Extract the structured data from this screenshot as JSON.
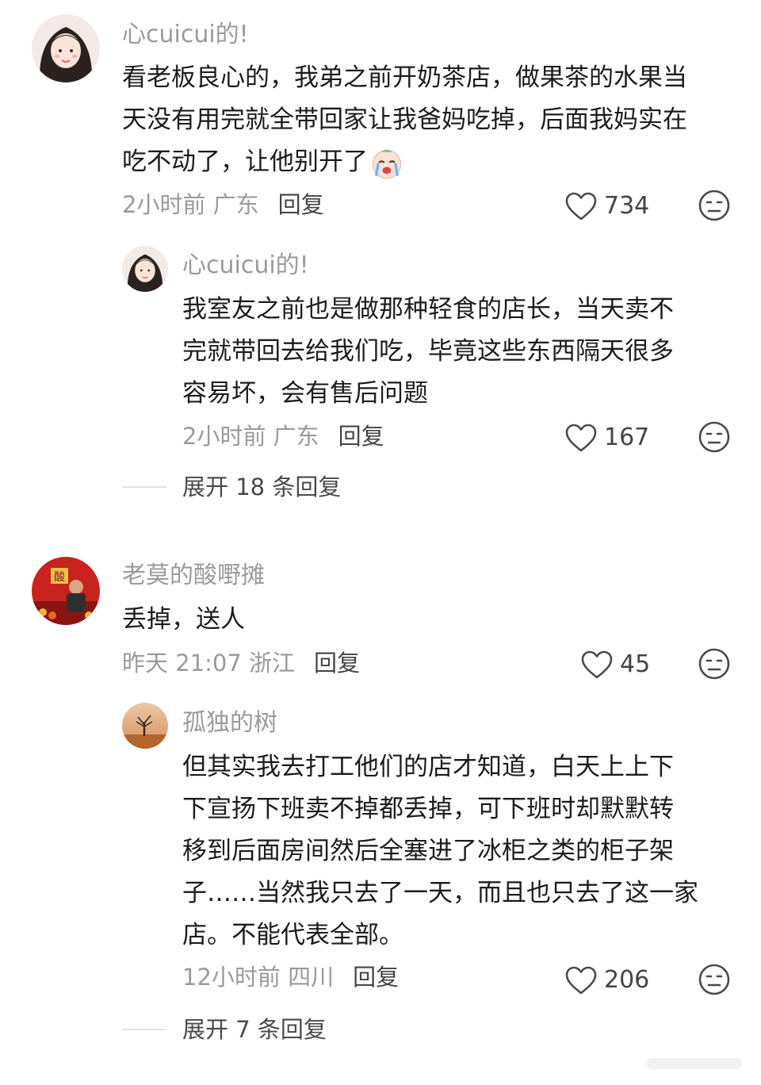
{
  "comments": [
    {
      "username": "心cuicui的!",
      "content_lines": [
        "看老板良心的，我弟之前开奶茶店，做果茶的水果当",
        "天没有用完就全带回家让我爸妈吃掉，后面我妈实在",
        "吃不动了，让他别开了"
      ],
      "emoji_icon": "crying-face-emoji",
      "time_location": "2小时前 广东",
      "reply_label": "回复",
      "likes": "734",
      "replies": [
        {
          "username": "心cuicui的!",
          "content_lines": [
            "我室友之前也是做那种轻食的店长，当天卖不",
            "完就带回去给我们吃，毕竟这些东西隔天很多",
            "容易坏，会有售后问题"
          ],
          "time_location": "2小时前 广东",
          "reply_label": "回复",
          "likes": "167"
        }
      ],
      "expand_label": "展开 18 条回复"
    },
    {
      "username": "老莫的酸嘢摊",
      "content_lines": [
        "丢掉，送人"
      ],
      "time_location": "昨天 21:07 浙江",
      "reply_label": "回复",
      "likes": "45",
      "replies": [
        {
          "username": "孤独的树",
          "content_lines": [
            "但其实我去打工他们的店才知道，白天上上下",
            "下宣扬下班卖不掉都丢掉，可下班时却默默转",
            "移到后面房间然后全塞进了冰柜之类的柜子架",
            "子……当然我只去了一天，而且也只去了这一家",
            "店。不能代表全部。"
          ],
          "time_location": "12小时前 四川",
          "reply_label": "回复",
          "likes": "206"
        }
      ],
      "expand_label": "展开 7 条回复"
    }
  ],
  "icons": {
    "like": "heart-outline-icon",
    "dislike": "meh-face-icon"
  },
  "colors": {
    "username": "#9a9a9a",
    "text": "#1c1c1c",
    "meta": "#9a9a9a"
  }
}
